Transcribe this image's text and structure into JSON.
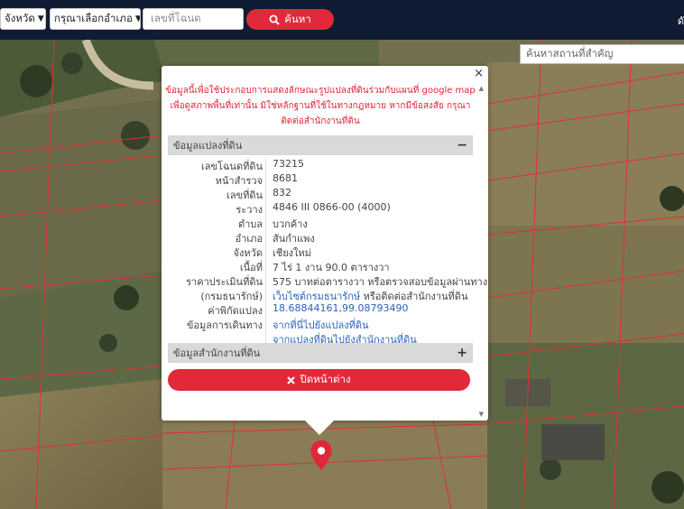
{
  "toolbar": {
    "province_select": "จังหวัด",
    "district_select": "กรุณาเลือกอำเภอ",
    "deed_placeholder": "เลขที่โฉนด",
    "search_button": "ค้นหา",
    "right_glyph": "ดั"
  },
  "map": {
    "place_search_placeholder": "ค้นหาสถานที่สำคัญ"
  },
  "popup": {
    "close_glyph": "×",
    "notice_lines": [
      "ข้อมูลนี้เพื่อใช้ประกอบการแสดงลักษณะรูปแปลงที่ดินร่วมกับแผนที่ google map",
      "เพื่อดูสภาพพื้นที่เท่านั้น มิใช่หลักฐานที่ใช้ในทางกฎหมาย หากมีข้อสงสัย กรุณา",
      "ติดต่อสำนักงานที่ดิน"
    ],
    "section_land": {
      "title": "ข้อมูลแปลงที่ดิน",
      "toggle": "−"
    },
    "rows": [
      {
        "label": "เลขโฉนดที่ดิน",
        "value": "73215"
      },
      {
        "label": "หน้าสำรวจ",
        "value": "8681"
      },
      {
        "label": "เลขที่ดิน",
        "value": "832"
      },
      {
        "label": "ระวาง",
        "value": "4846 III 0866-00 (4000)"
      },
      {
        "label": "ตำบล",
        "value": "บวกค้าง"
      },
      {
        "label": "อำเภอ",
        "value": "สันกำแพง"
      },
      {
        "label": "จังหวัด",
        "value": "เชียงใหม่"
      },
      {
        "label": "เนื้อที่",
        "value": "7 ไร่ 1 งาน 90.0 ตารางวา"
      },
      {
        "label": "ราคาประเมินที่ดิน",
        "value": "575 บาทต่อตารางวา หรือตรวจสอบข้อมูลผ่านทาง"
      },
      {
        "label": "(กรมธนารักษ์)",
        "value_link": "เว็บไซต์กรมธนารักษ์",
        "value_rest": " หรือติดต่อสำนักงานที่ดิน"
      },
      {
        "label": "ค่าพิกัดแปลง",
        "value_link": "18.68844161,99.08793490"
      },
      {
        "label": "ข้อมูลการเดินทาง",
        "value_link": "จากที่นี่ไปยังแปลงที่ดิน"
      },
      {
        "value_link": "จากแปลงที่ดินไปยังสำนักงานที่ดิน"
      }
    ],
    "section_office": {
      "title": "ข้อมูลสำนักงานที่ดิน",
      "toggle": "+"
    },
    "close_button": "ปิดหน้าต่าง"
  },
  "colors": {
    "topbar": "#0f1c33",
    "accent_red": "#e02a3a",
    "link_blue": "#2a63b8",
    "notice_red": "#e0263a"
  }
}
